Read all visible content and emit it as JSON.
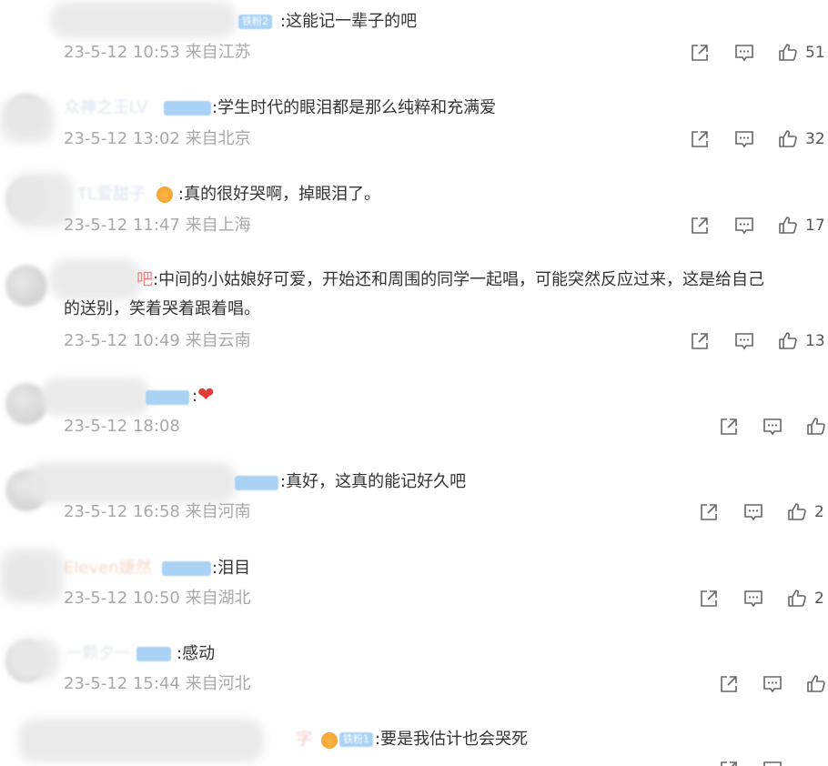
{
  "comments": [
    {
      "badge": "铁粉2",
      "text": ":这能记一辈子的吧",
      "time": "23-5-12 10:53",
      "location": "来自江苏",
      "likes": "51"
    },
    {
      "name": "众神之王LV",
      "text": ":学生时代的眼泪都是那么纯粹和充满爱",
      "time": "23-5-12 13:02",
      "location": "来自北京",
      "likes": "32"
    },
    {
      "name": "TL爱甜子",
      "text": ":真的很好哭啊，掉眼泪了。",
      "time": "23-5-12 11:47",
      "location": "来自上海",
      "likes": "17"
    },
    {
      "name": "吧",
      "text_line1": ":中间的小姑娘好可爱，开始还和周围的同学一起唱，可能突然反应过来，这是给自己",
      "text_line2": "的送别，笑着哭着跟着唱。",
      "time": "23-5-12 10:49",
      "location": "来自云南",
      "likes": "13"
    },
    {
      "text": ":",
      "emoji": "❤",
      "time": "23-5-12 18:08"
    },
    {
      "text": ":真好，这真的能记好久吧",
      "time": "23-5-12 16:58",
      "location": "来自河南",
      "likes": "2"
    },
    {
      "name": "Eleven婕然",
      "text": ":泪目",
      "time": "23-5-12 10:50",
      "location": "来自湖北",
      "likes": "2"
    },
    {
      "name": "一颗夕一",
      "text": ":感动",
      "time": "23-5-12 15:44",
      "location": "来自河北"
    },
    {
      "name": "字",
      "badge": "铁粉1",
      "text": ":要是我估计也会哭死"
    }
  ],
  "icons": {
    "share": "share-icon",
    "comment": "comment-icon",
    "like": "like-icon"
  },
  "colors": {
    "text": "#333333",
    "meta": "#a8a8a8",
    "badge": "#a9d2f5",
    "heart": "#e53935"
  }
}
